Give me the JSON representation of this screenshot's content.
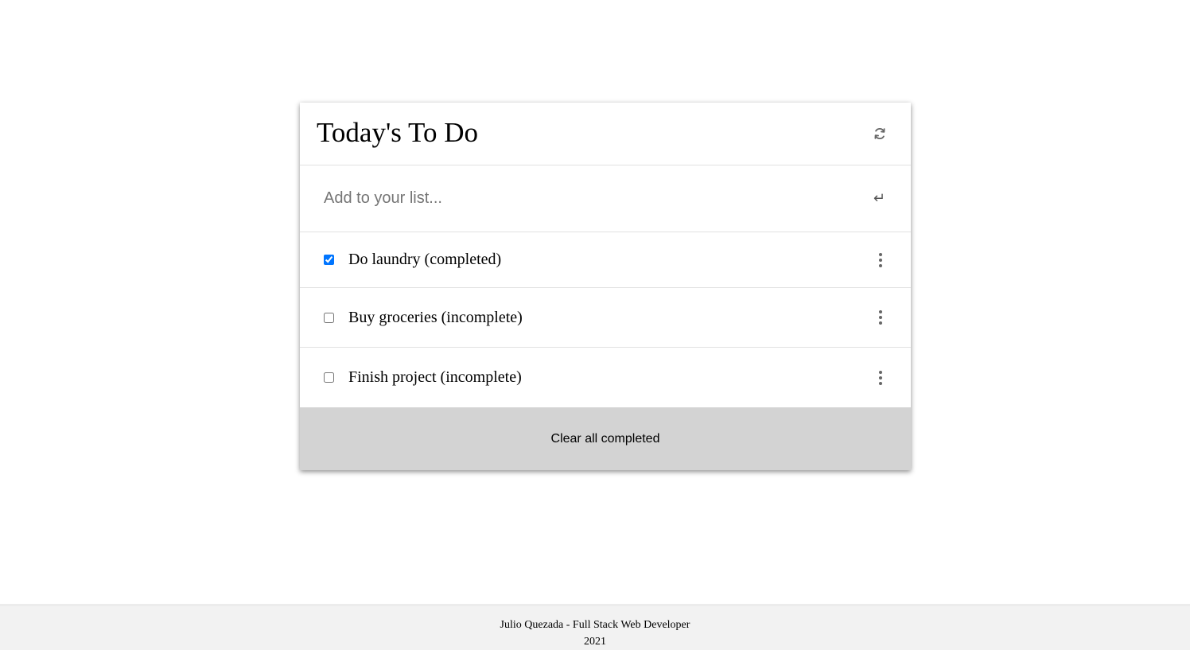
{
  "header": {
    "title": "Today's To Do",
    "refresh_icon": "refresh-icon"
  },
  "add": {
    "placeholder": "Add to your list...",
    "enter_icon": "↵"
  },
  "items": [
    {
      "label": "Do laundry (completed)",
      "completed": true
    },
    {
      "label": "Buy groceries (incomplete)",
      "completed": false
    },
    {
      "label": "Finish project (incomplete)",
      "completed": false
    }
  ],
  "actions": {
    "clear_label": "Clear all completed"
  },
  "footer": {
    "line1": "Julio Quezada - Full Stack Web Developer",
    "line2": "2021"
  },
  "colors": {
    "checkbox_accent": "#0075ff",
    "clear_bg": "#d3d3d3",
    "footer_bg": "#f2f2f2"
  }
}
